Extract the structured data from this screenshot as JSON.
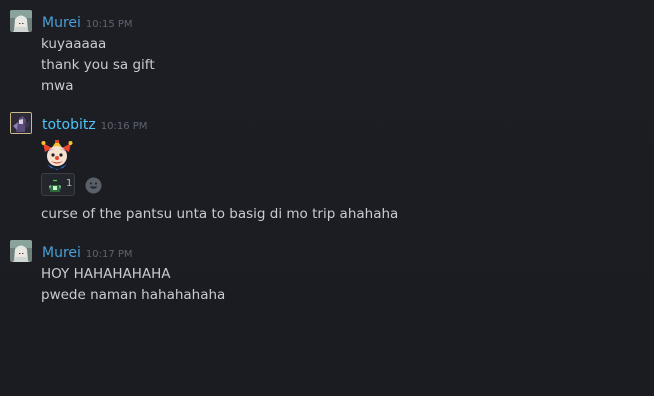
{
  "colors": {
    "background": "#1b1d23",
    "name_murei": "#4a9fd6",
    "name_totobitz": "#4fc3f7",
    "text": "#c8cbd2",
    "timestamp": "#5f6470"
  },
  "messages": [
    {
      "author": "Murei",
      "time": "10:15 PM",
      "avatar_icon": "white-haired-character-avatar",
      "lines": [
        "kuyaaaaa",
        "thank you sa gift",
        "mwa"
      ]
    },
    {
      "author": "totobitz",
      "time": "10:16 PM",
      "avatar_icon": "dark-character-avatar",
      "sticker_icon": "jester-emoticon",
      "reaction": {
        "icon": "green-figure-emoticon",
        "count": "1"
      },
      "add_reaction_icon": "smiley-face-icon",
      "lines": [
        "curse of the pantsu unta to basig di mo trip ahahaha"
      ]
    },
    {
      "author": "Murei",
      "time": "10:17 PM",
      "avatar_icon": "white-haired-character-avatar",
      "lines": [
        "HOY HAHAHAHAHA",
        "pwede naman hahahahaha"
      ]
    }
  ]
}
